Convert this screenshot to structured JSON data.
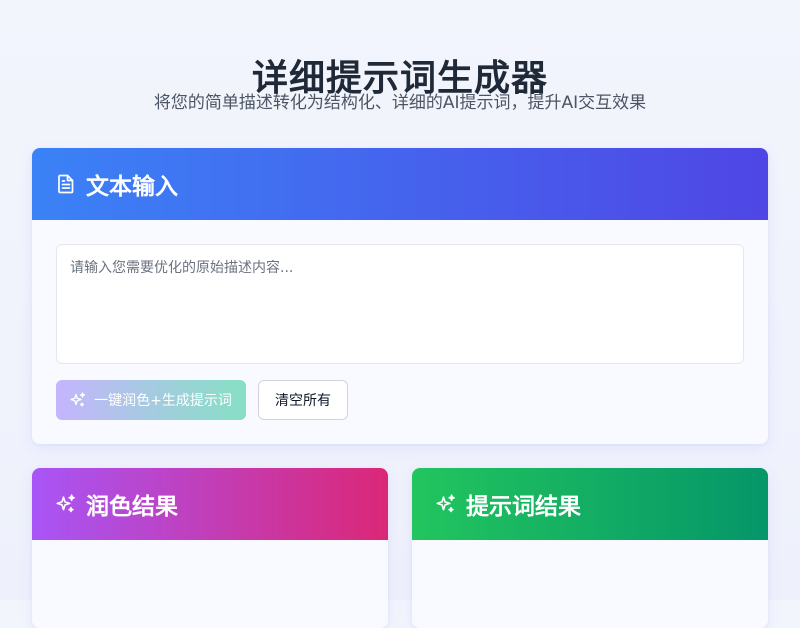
{
  "header": {
    "title": "详细提示词生成器",
    "subtitle": "将您的简单描述转化为结构化、详细的AI提示词，提升AI交互效果"
  },
  "input_card": {
    "title": "文本输入",
    "icon": "document-icon",
    "textarea": {
      "value": "",
      "placeholder": "请输入您需要优化的原始描述内容..."
    },
    "generate_button_label": "一键润色+生成提示词",
    "generate_button_icon": "sparkles-icon",
    "clear_button_label": "清空所有"
  },
  "polish_card": {
    "title": "润色结果",
    "icon": "sparkles-icon"
  },
  "prompt_card": {
    "title": "提示词结果",
    "icon": "sparkles-icon"
  },
  "colors": {
    "input_header_start": "#3b82f6",
    "input_header_end": "#4f46e5",
    "polish_header_start": "#a855f7",
    "polish_header_end": "#db2777",
    "prompt_header_start": "#22c55e",
    "prompt_header_end": "#059669",
    "generate_button_start": "#c4b5fd",
    "generate_button_end": "#86e0c4"
  }
}
